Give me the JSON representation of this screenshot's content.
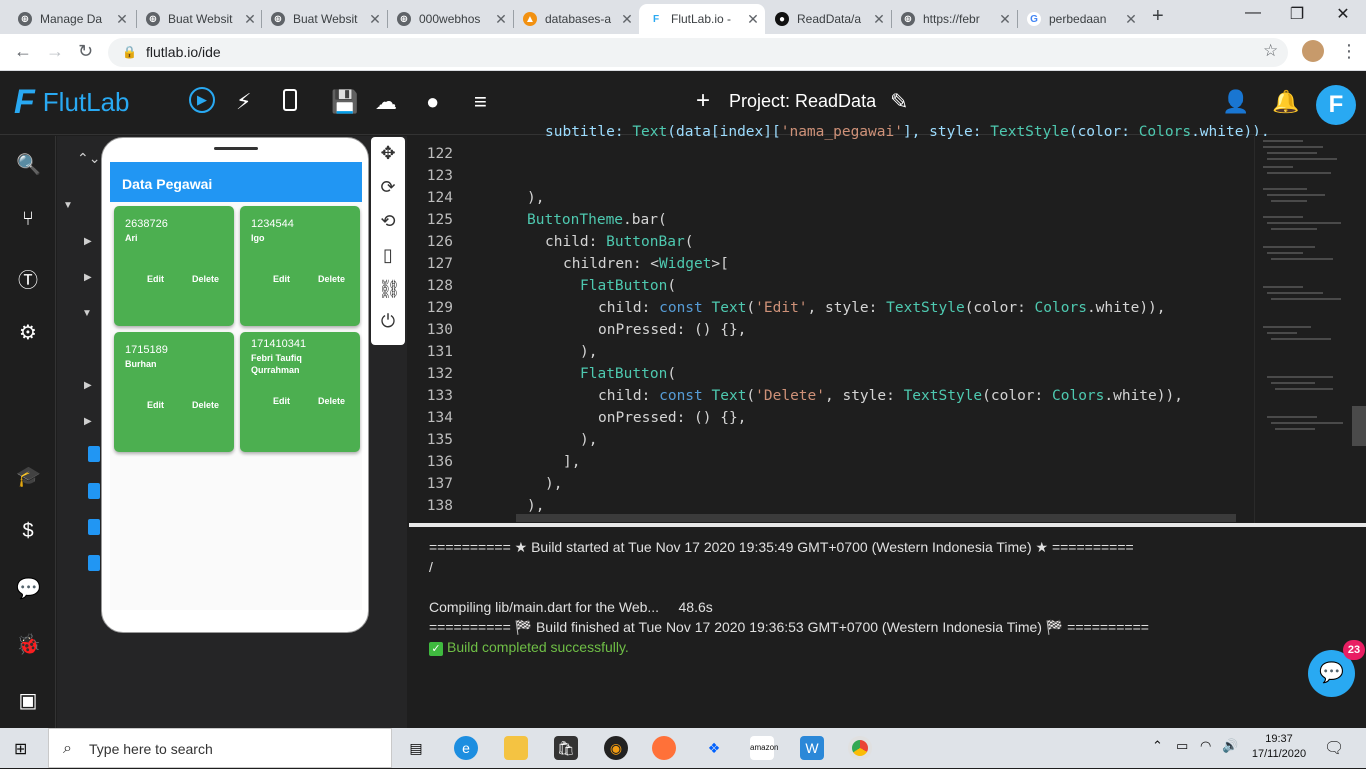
{
  "browser": {
    "tabs": [
      {
        "title": "Manage Da",
        "favicon": "globe-icon"
      },
      {
        "title": "Buat Websit",
        "favicon": "globe-icon"
      },
      {
        "title": "Buat Websit",
        "favicon": "globe-icon"
      },
      {
        "title": "000webhos",
        "favicon": "globe-icon"
      },
      {
        "title": "databases-a",
        "favicon": "phpmyadmin-icon"
      },
      {
        "title": "FlutLab.io -",
        "favicon": "flutlab-icon"
      },
      {
        "title": "ReadData/a",
        "favicon": "github-icon"
      },
      {
        "title": "https://febr",
        "favicon": "globe-icon"
      },
      {
        "title": "perbedaan",
        "favicon": "google-icon"
      }
    ],
    "new_tab": "+",
    "url": "flutlab.io/ide",
    "controls": {
      "minimize": "—",
      "maximize": "❐",
      "close": "✕"
    }
  },
  "flutlab": {
    "logo_text": "FlutLab",
    "project_title": "Project: ReadData",
    "add_label": "+",
    "avatar_letter": "F"
  },
  "preview": {
    "appbar_title": "Data Pegawai",
    "cards": [
      {
        "id": "2638726",
        "name": "Ari",
        "edit": "Edit",
        "delete": "Delete"
      },
      {
        "id": "1234544",
        "name": "Igo",
        "edit": "Edit",
        "delete": "Delete"
      },
      {
        "id": "1715189",
        "name": "Burhan",
        "edit": "Edit",
        "delete": "Delete"
      },
      {
        "id": "171410341",
        "name": "Febri Taufiq Qurrahman",
        "edit": "Edit",
        "delete": "Delete"
      }
    ]
  },
  "editor": {
    "lines": [
      {
        "n": "122"
      },
      {
        "n": "123"
      },
      {
        "n": "124"
      },
      {
        "n": "125"
      },
      {
        "n": "126"
      },
      {
        "n": "127"
      },
      {
        "n": "128"
      },
      {
        "n": "129"
      },
      {
        "n": "130"
      },
      {
        "n": "131"
      },
      {
        "n": "132"
      },
      {
        "n": "133"
      },
      {
        "n": "134"
      },
      {
        "n": "135"
      },
      {
        "n": "136"
      },
      {
        "n": "137"
      },
      {
        "n": "138"
      }
    ]
  },
  "console": {
    "lines": [
      "========== ★ Build started at Tue Nov 17 2020 19:35:49 GMT+0700 (Western Indonesia Time) ★ ==========",
      "/",
      "",
      "Compiling lib/main.dart for the Web...     48.6s",
      "========== 🏁 Build finished at Tue Nov 17 2020 19:36:53 GMT+0700 (Western Indonesia Time) 🏁 =========="
    ],
    "success": "Build completed successfully.",
    "chat_badge": "23"
  },
  "taskbar": {
    "search_placeholder": "Type here to search",
    "time": "19:37",
    "date": "17/11/2020"
  },
  "colors": {
    "accent": "#29a9f2",
    "card_green": "#4caf50",
    "appbar_blue": "#2196f3",
    "success_green": "#6fbf46"
  }
}
